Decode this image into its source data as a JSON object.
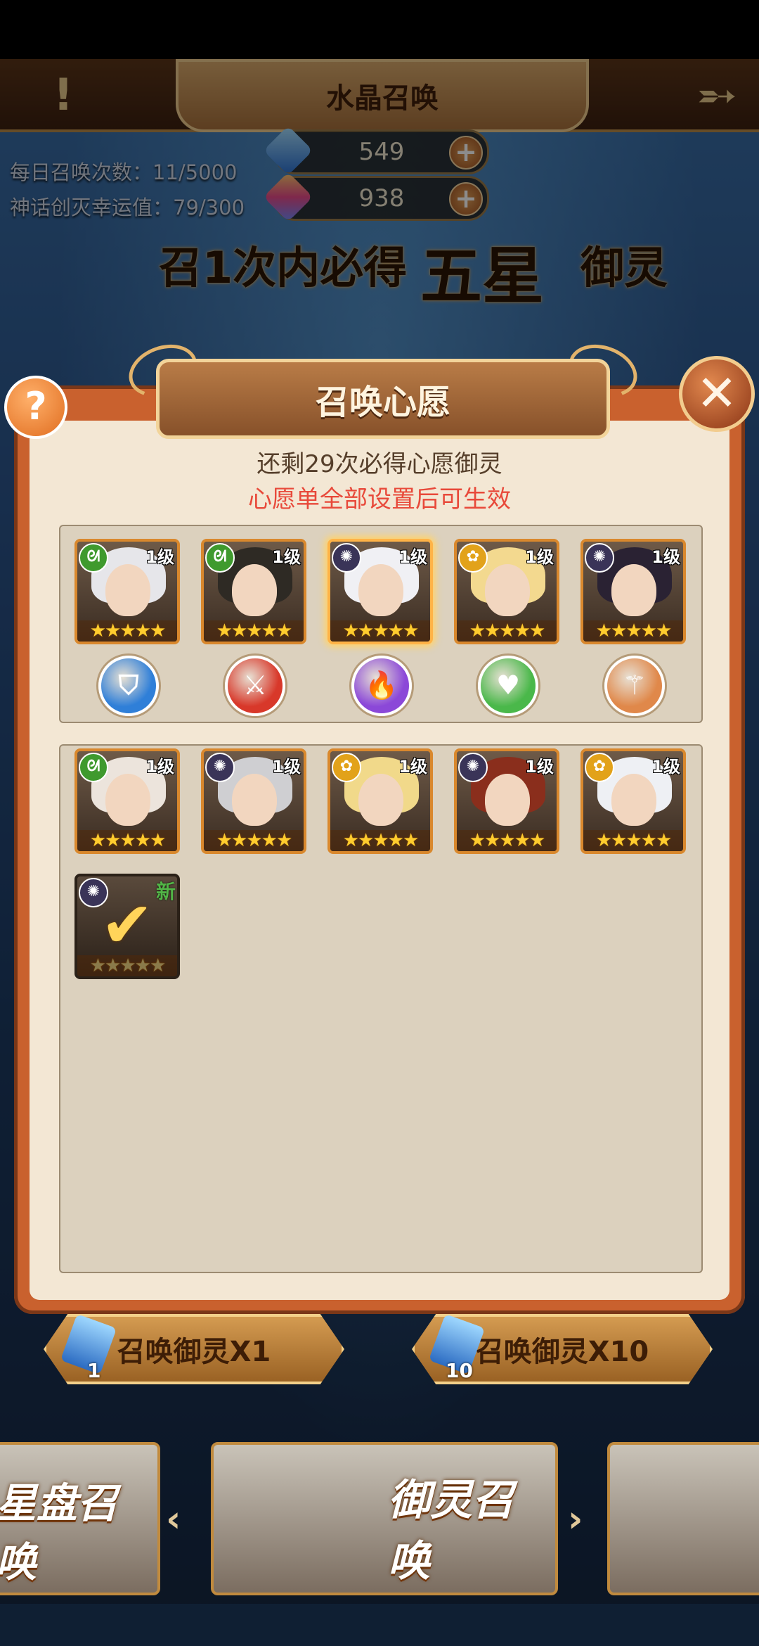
{
  "header": {
    "title": "水晶召唤",
    "back_label": "➵"
  },
  "stats": {
    "daily_summons": "每日召唤次数：11/5000",
    "luck_value": "神话创灭幸运值：79/300"
  },
  "currency": [
    {
      "value": "549",
      "color": "#4aa4ff"
    },
    {
      "value": "938",
      "color": "#ff7a4a"
    }
  ],
  "banner": {
    "part1": "召1次内必得",
    "part2": "五星",
    "part3": "御灵"
  },
  "dialog": {
    "title": "召唤心愿",
    "remaining": "还剩29次必得心愿御灵",
    "hint": "心愿单全部设置后可生效",
    "help_label": "?",
    "close_label": "✕"
  },
  "wish_list": [
    {
      "level": "1级",
      "element": "ᘛ",
      "element_color": "#3f9a2e",
      "hair": "#e6e6ea",
      "stars": "★★★★★"
    },
    {
      "level": "1级",
      "element": "ᘛ",
      "element_color": "#3f9a2e",
      "hair": "#2e2a24",
      "stars": "★★★★★"
    },
    {
      "level": "1级",
      "element": "✺",
      "element_color": "#3a3458",
      "hair": "#f0f0f4",
      "stars": "★★★★★",
      "selected": true
    },
    {
      "level": "1级",
      "element": "✿",
      "element_color": "#e2a21a",
      "hair": "#f3d98f",
      "stars": "★★★★★"
    },
    {
      "level": "1级",
      "element": "✺",
      "element_color": "#3a3458",
      "hair": "#2a2233",
      "stars": "★★★★★"
    }
  ],
  "class_icons": [
    {
      "name": "defender-class-icon",
      "glyph": "⛉",
      "color": "#2f7fd8"
    },
    {
      "name": "warrior-class-icon",
      "glyph": "⚔",
      "color": "#d8382a"
    },
    {
      "name": "mage-class-icon",
      "glyph": "🔥",
      "color": "#8b48d8"
    },
    {
      "name": "healer-class-icon",
      "glyph": "♥",
      "color": "#4ab84a"
    },
    {
      "name": "support-class-icon",
      "glyph": "⚚",
      "color": "#e0884a"
    }
  ],
  "roster": [
    {
      "level": "1级",
      "element": "ᘛ",
      "element_color": "#3f9a2e",
      "hair": "#ece4dc",
      "stars": "★★★★★"
    },
    {
      "level": "1级",
      "element": "✺",
      "element_color": "#3a3458",
      "hair": "#cfcfd2",
      "stars": "★★★★★"
    },
    {
      "level": "1级",
      "element": "✿",
      "element_color": "#e2a21a",
      "hair": "#f1d98a",
      "stars": "★★★★★"
    },
    {
      "level": "1级",
      "element": "✺",
      "element_color": "#3a3458",
      "hair": "#8a2e1c",
      "stars": "★★★★★"
    },
    {
      "level": "1级",
      "element": "✿",
      "element_color": "#e2a21a",
      "hair": "#eef0f4",
      "stars": "★★★★★"
    }
  ],
  "selected_slot": {
    "element": "✺",
    "element_color": "#3a3458",
    "new_label": "新",
    "check": "✔",
    "stars": "★★★★★"
  },
  "summon_buttons": [
    {
      "label": "召唤御灵X1",
      "count": "1"
    },
    {
      "label": "召唤御灵X10",
      "count": "10"
    }
  ],
  "carousel": {
    "left_label": "星盘召唤",
    "center_label": "御灵召唤",
    "prev_arrow": "‹",
    "next_arrow": "›"
  }
}
